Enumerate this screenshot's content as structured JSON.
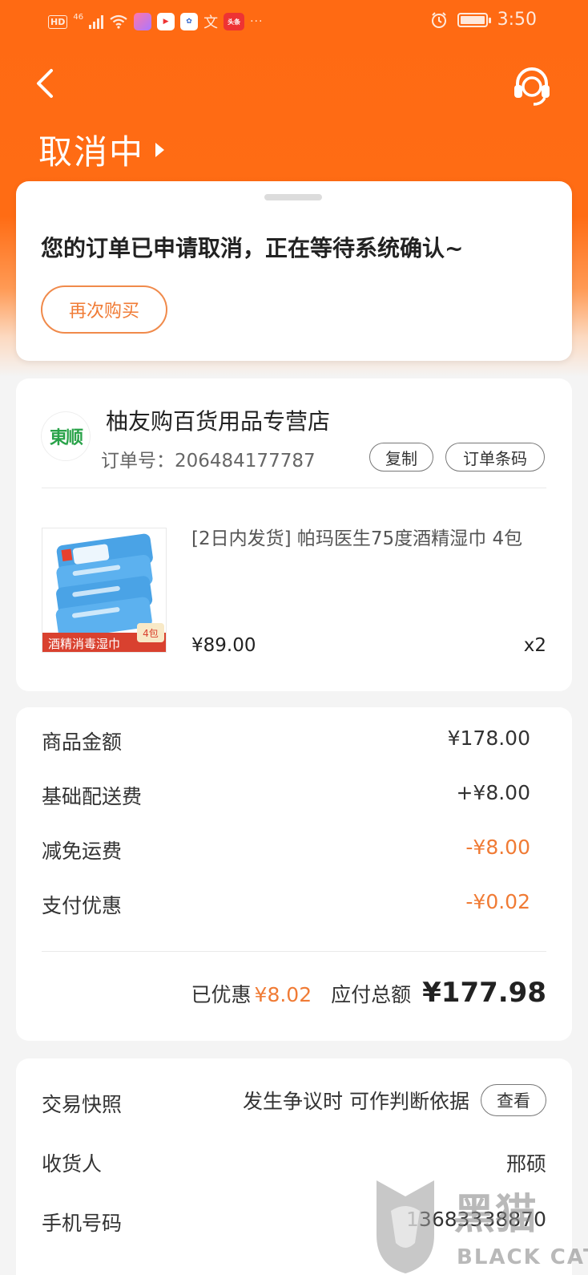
{
  "status_bar": {
    "hd": "HD",
    "network": "46",
    "time": "3:50",
    "app_icons": [
      "app-1",
      "app-2",
      "app-3"
    ]
  },
  "header": {
    "status_title": "取消中"
  },
  "status_card": {
    "message": "您的订单已申请取消，正在等待系统确认~",
    "rebuy_label": "再次购买"
  },
  "store": {
    "logo_text": "東顺",
    "name": "柚友购百货用品专营店",
    "order_label": "订单号：",
    "order_no": "206484177787",
    "copy_label": "复制",
    "barcode_label": "订单条码"
  },
  "product": {
    "title": "[2日内发货] 帕玛医生75度酒精湿巾 4包",
    "price": "¥89.00",
    "qty": "x2",
    "img_banner": "酒精消毒湿巾",
    "img_badge": "4包"
  },
  "amounts": {
    "rows": [
      {
        "label": "商品金额",
        "value": "¥178.00"
      },
      {
        "label": "基础配送费",
        "value": "+¥8.00"
      },
      {
        "label": "减免运费",
        "value": "-¥8.00"
      },
      {
        "label": "支付优惠",
        "value": "-¥0.02"
      }
    ],
    "discount_label": "已优惠",
    "discount_value": "¥8.02",
    "total_label": "应付总额",
    "total_value": "¥177.98"
  },
  "info": {
    "snapshot_label": "交易快照",
    "snapshot_hint": "发生争议时 可作判断依据",
    "view_label": "查看",
    "receiver_label": "收货人",
    "receiver_value": "邢硕",
    "phone_label": "手机号码",
    "phone_value": "13683338870"
  },
  "watermark": {
    "cn": "黑猫",
    "en": "BLACK CAT"
  },
  "colors": {
    "brand_orange": "#ff6a13",
    "accent_orange": "#f07b35"
  }
}
